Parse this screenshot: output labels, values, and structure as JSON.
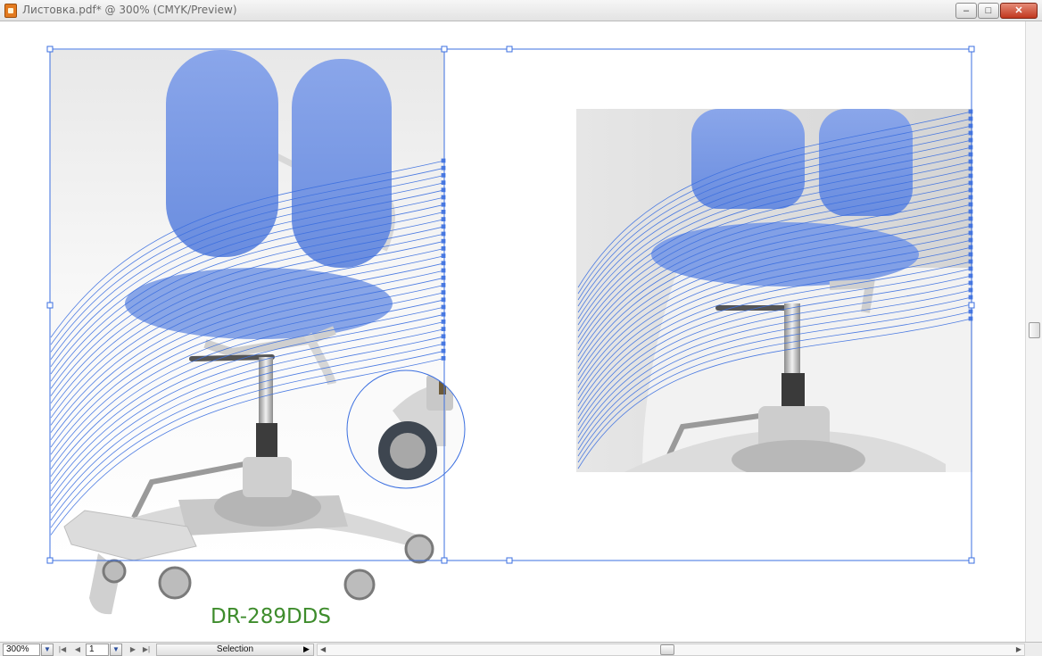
{
  "window": {
    "title": "Листовка.pdf* @ 300% (CMYK/Preview)",
    "minimize_glyph": "–",
    "maximize_glyph": "□",
    "close_glyph": "✕"
  },
  "artboard": {
    "product_label": "DR-289DDS",
    "label_color": "#3e8c2c",
    "selection_color": "#3b6fe0",
    "chair_color": "#7a9be3"
  },
  "statusbar": {
    "zoom": "300%",
    "page": "1",
    "tool": "Selection"
  },
  "icons": {
    "doc": "illustrator-doc-icon",
    "zoom_dropdown": "chevron-down-icon",
    "first_page": "first-page-icon",
    "prev_page": "prev-page-icon",
    "next_page": "next-page-icon",
    "last_page": "last-page-icon",
    "tool_menu": "play-arrow-icon"
  }
}
